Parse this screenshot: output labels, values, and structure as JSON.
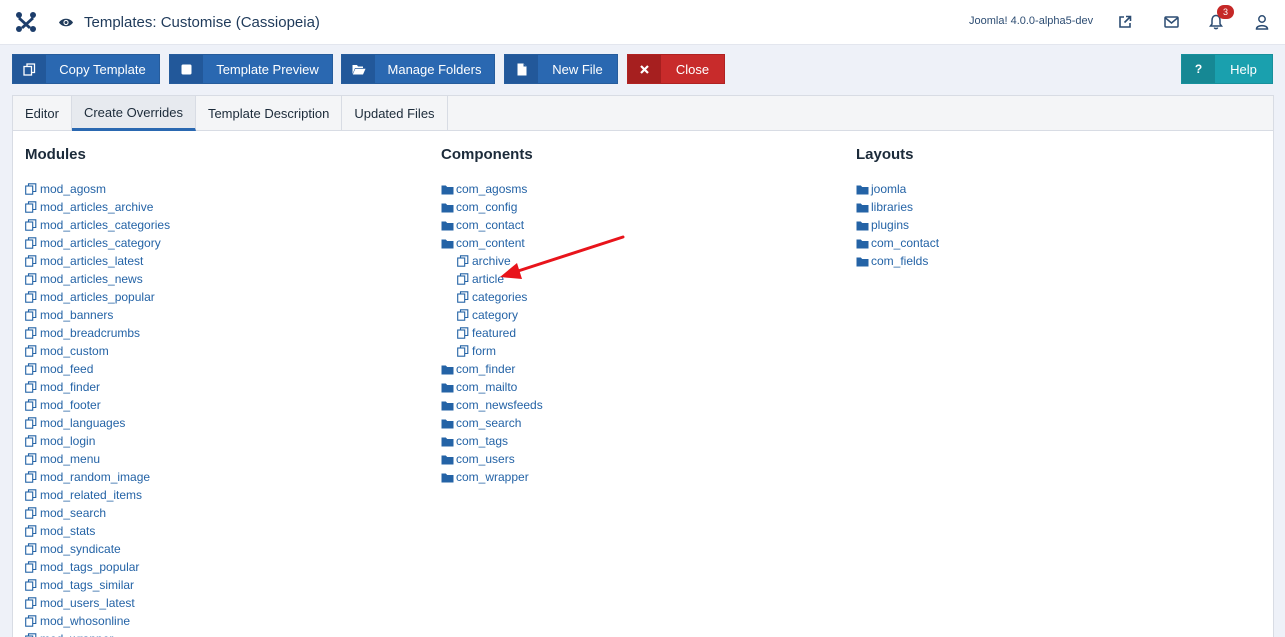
{
  "header": {
    "title": "Templates: Customise (Cassiopeia)",
    "version": "Joomla! 4.0.0-alpha5-dev",
    "notifications_count": "3",
    "accent": "#1f3a5a"
  },
  "toolbar": {
    "copy_label": "Copy Template",
    "preview_label": "Template Preview",
    "folders_label": "Manage Folders",
    "newfile_label": "New File",
    "close_label": "Close",
    "help_label": "Help"
  },
  "tabs": [
    "Editor",
    "Create Overrides",
    "Template Description",
    "Updated Files"
  ],
  "modules": {
    "heading": "Modules",
    "items": [
      "mod_agosm",
      "mod_articles_archive",
      "mod_articles_categories",
      "mod_articles_category",
      "mod_articles_latest",
      "mod_articles_news",
      "mod_articles_popular",
      "mod_banners",
      "mod_breadcrumbs",
      "mod_custom",
      "mod_feed",
      "mod_finder",
      "mod_footer",
      "mod_languages",
      "mod_login",
      "mod_menu",
      "mod_random_image",
      "mod_related_items",
      "mod_search",
      "mod_stats",
      "mod_syndicate",
      "mod_tags_popular",
      "mod_tags_similar",
      "mod_users_latest",
      "mod_whosonline",
      "mod_wrapper"
    ]
  },
  "components": {
    "heading": "Components",
    "items": [
      {
        "label": "com_agosms",
        "type": "folder"
      },
      {
        "label": "com_config",
        "type": "folder"
      },
      {
        "label": "com_contact",
        "type": "folder"
      },
      {
        "label": "com_content",
        "type": "folder"
      },
      {
        "label": "archive",
        "type": "copy",
        "sub": true
      },
      {
        "label": "article",
        "type": "copy",
        "sub": true
      },
      {
        "label": "categories",
        "type": "copy",
        "sub": true
      },
      {
        "label": "category",
        "type": "copy",
        "sub": true
      },
      {
        "label": "featured",
        "type": "copy",
        "sub": true
      },
      {
        "label": "form",
        "type": "copy",
        "sub": true
      },
      {
        "label": "com_finder",
        "type": "folder"
      },
      {
        "label": "com_mailto",
        "type": "folder"
      },
      {
        "label": "com_newsfeeds",
        "type": "folder"
      },
      {
        "label": "com_search",
        "type": "folder"
      },
      {
        "label": "com_tags",
        "type": "folder"
      },
      {
        "label": "com_users",
        "type": "folder"
      },
      {
        "label": "com_wrapper",
        "type": "folder"
      }
    ]
  },
  "layouts": {
    "heading": "Layouts",
    "items": [
      "joomla",
      "libraries",
      "plugins",
      "com_contact",
      "com_fields"
    ]
  },
  "colors": {
    "link": "#2463a6",
    "primary_button": "#2a68b1",
    "close_button": "#c82b2b",
    "help_button": "#1aa0ae",
    "annotation_arrow": "#e8141b"
  }
}
